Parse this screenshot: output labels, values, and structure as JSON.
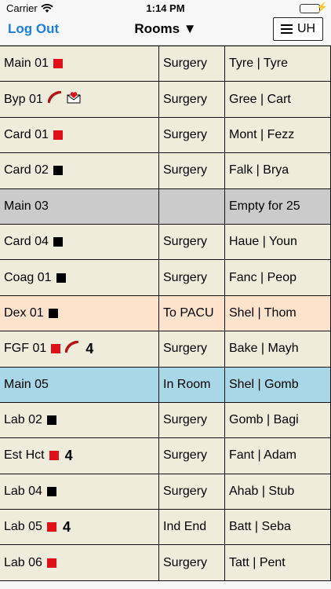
{
  "status_bar": {
    "carrier": "Carrier",
    "time": "1:14 PM"
  },
  "nav": {
    "logout_label": "Log Out",
    "title": "Rooms ▼",
    "menu_label": "UH"
  },
  "colors": {
    "default_row": "#f0ecdc",
    "gray_row": "#cbcbcb",
    "peach_row": "#fde2cc",
    "blue_row": "#a8d8e8",
    "red_marker": "#e0101a",
    "black_marker": "#000000",
    "logout": "#1a7fd8"
  },
  "rows": [
    {
      "room": "Main 01",
      "marker": "red",
      "icons": [],
      "count": "",
      "status": "Surgery",
      "names": "Tyre | Tyre",
      "color": "default"
    },
    {
      "room": "Byp 01",
      "marker": "",
      "icons": [
        "curved-line-icon",
        "heart-envelope-icon"
      ],
      "count": "",
      "status": "Surgery",
      "names": "Gree | Cart",
      "color": "default"
    },
    {
      "room": "Card 01",
      "marker": "red",
      "icons": [],
      "count": "",
      "status": "Surgery",
      "names": "Mont | Fezz",
      "color": "default"
    },
    {
      "room": "Card 02",
      "marker": "black",
      "icons": [],
      "count": "",
      "status": "Surgery",
      "names": "Falk | Brya",
      "color": "default"
    },
    {
      "room": "Main 03",
      "marker": "",
      "icons": [],
      "count": "",
      "status": "",
      "names": "Empty for 25",
      "color": "gray"
    },
    {
      "room": "Card 04",
      "marker": "black",
      "icons": [],
      "count": "",
      "status": "Surgery",
      "names": "Haue | Youn",
      "color": "default"
    },
    {
      "room": "Coag 01",
      "marker": "black",
      "icons": [],
      "count": "",
      "status": "Surgery",
      "names": "Fanc | Peop",
      "color": "default"
    },
    {
      "room": "Dex 01",
      "marker": "black",
      "icons": [],
      "count": "",
      "status": "To PACU",
      "names": "Shel | Thom",
      "color": "peach"
    },
    {
      "room": "FGF 01",
      "marker": "red",
      "icons": [
        "curved-line-icon"
      ],
      "count": "4",
      "status": "Surgery",
      "names": "Bake | Mayh",
      "color": "default"
    },
    {
      "room": "Main 05",
      "marker": "",
      "icons": [],
      "count": "",
      "status": "In Room",
      "names": "Shel | Gomb",
      "color": "blue"
    },
    {
      "room": "Lab 02",
      "marker": "black",
      "icons": [],
      "count": "",
      "status": "Surgery",
      "names": "Gomb | Bagi",
      "color": "default"
    },
    {
      "room": "Est Hct",
      "marker": "red",
      "icons": [],
      "count": "4",
      "status": "Surgery",
      "names": "Fant | Adam",
      "color": "default"
    },
    {
      "room": "Lab 04",
      "marker": "black",
      "icons": [],
      "count": "",
      "status": "Surgery",
      "names": "Ahab | Stub",
      "color": "default"
    },
    {
      "room": "Lab 05",
      "marker": "red",
      "icons": [],
      "count": "4",
      "status": "Ind End",
      "names": "Batt | Seba",
      "color": "default"
    },
    {
      "room": "Lab 06",
      "marker": "red",
      "icons": [],
      "count": "",
      "status": "Surgery",
      "names": "Tatt | Pent",
      "color": "default"
    }
  ]
}
